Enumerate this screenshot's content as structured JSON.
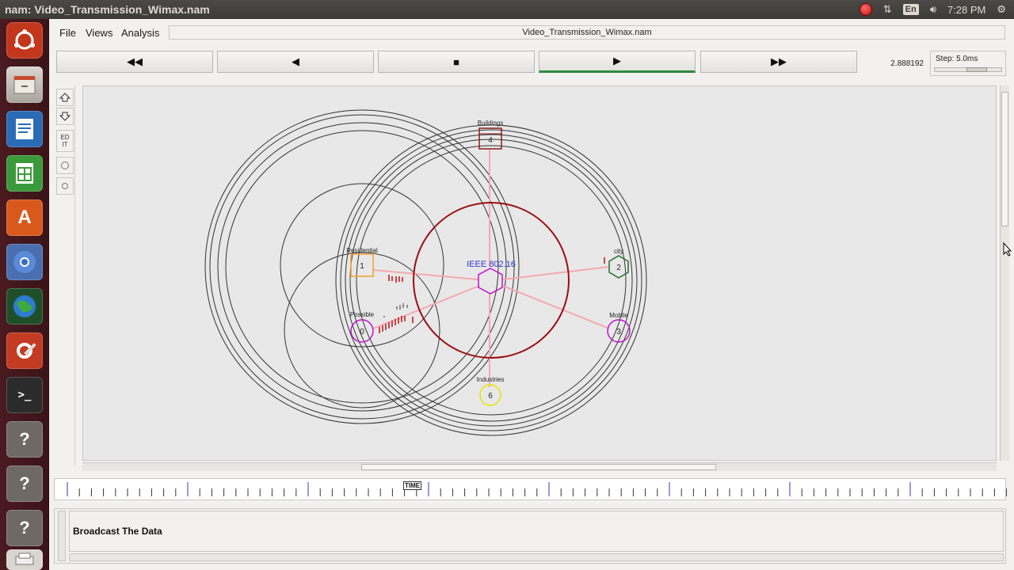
{
  "system_bar": {
    "window_title": "nam: Video_Transmission_Wimax.nam",
    "lang": "En",
    "time": "7:28 PM"
  },
  "launcher": {
    "items": [
      {
        "name": "ubuntu-dash-icon"
      },
      {
        "name": "files-icon"
      },
      {
        "name": "writer-icon"
      },
      {
        "name": "calc-icon"
      },
      {
        "name": "software-center-icon"
      },
      {
        "name": "chromium-icon"
      },
      {
        "name": "globe-icon"
      },
      {
        "name": "settings-icon"
      },
      {
        "name": "terminal-icon"
      },
      {
        "name": "unknown-app-icon-1",
        "glyph": "?"
      },
      {
        "name": "unknown-app-icon-2",
        "glyph": "?"
      },
      {
        "name": "unknown-app-icon-3",
        "glyph": "?"
      },
      {
        "name": "printer-icon"
      }
    ]
  },
  "menu": {
    "file": "File",
    "views": "Views",
    "analysis": "Analysis",
    "filename": "Video_Transmission_Wimax.nam"
  },
  "controls": {
    "rewind": "◀◀",
    "back": "◀",
    "stop": "■",
    "play": "▶",
    "forward": "▶▶",
    "time": "2.888192",
    "step_label": "Step: 5.0ms"
  },
  "tools": {
    "edit": "ED IT"
  },
  "network": {
    "nodes": [
      {
        "id": "node-0",
        "num": "0",
        "label": "Possible"
      },
      {
        "id": "node-1",
        "num": "1",
        "label": "Residential"
      },
      {
        "id": "node-2",
        "num": "2",
        "label": "city"
      },
      {
        "id": "node-3",
        "num": "3",
        "label": "Mobile"
      },
      {
        "id": "node-4",
        "num": "4",
        "label": "Buildings"
      },
      {
        "id": "node-5",
        "num": "",
        "label": "IEEE 802.16"
      },
      {
        "id": "node-6",
        "num": "6",
        "label": "Industries"
      }
    ],
    "colors": {
      "link": "#f4a8b0",
      "bs_circle": "#9b0d12",
      "orange": "#f0a030",
      "magenta": "#c010d0",
      "green": "#1f6f2a",
      "darkred": "#8b1a1a",
      "yellow": "#e6e600",
      "blue_text": "#3333cc"
    }
  },
  "timeline": {
    "marker": "TIME"
  },
  "annotation": {
    "message": "Broadcast The Data"
  }
}
